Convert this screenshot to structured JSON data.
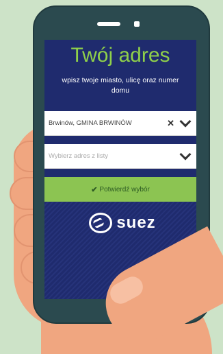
{
  "screen": {
    "title": "Twój adres",
    "subtitle": "wpisz twoje miasto, ulicę oraz numer domu",
    "city_field": {
      "value": "Brwinów, GMINA BRWINÓW",
      "clear_icon": "✕"
    },
    "address_field": {
      "placeholder": "Wybierz adres z listy"
    },
    "confirm_button": {
      "icon": "✔",
      "label": "Potwierdź wybór"
    },
    "logo_text": "suez"
  },
  "colors": {
    "background": "#cde3c8",
    "screen": "#1f2b6e",
    "accent_green": "#8cc452",
    "title_green": "#8fd04a",
    "phone_body": "#2b4a4f",
    "skin": "#f0a680"
  },
  "icons": [
    "close-icon",
    "chevron-down-icon",
    "check-icon",
    "suez-logo-icon"
  ]
}
